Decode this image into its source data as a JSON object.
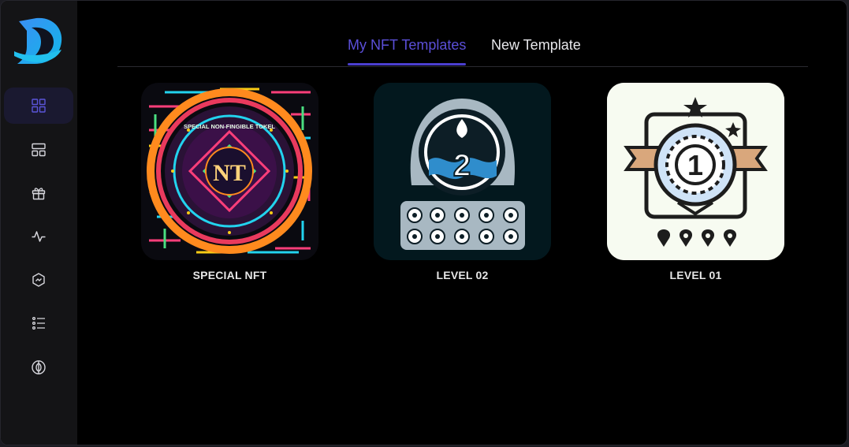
{
  "tabs": {
    "my_templates": "My NFT Templates",
    "new_template": "New Template"
  },
  "sidebar": {
    "items": [
      {
        "icon": "dashboard-grid-icon",
        "active": true
      },
      {
        "icon": "layout-icon",
        "active": false
      },
      {
        "icon": "gift-icon",
        "active": false
      },
      {
        "icon": "activity-icon",
        "active": false
      },
      {
        "icon": "badge-icon",
        "active": false
      },
      {
        "icon": "list-icon",
        "active": false
      },
      {
        "icon": "brain-icon",
        "active": false
      }
    ]
  },
  "cards": [
    {
      "title": "SPECIAL NFT",
      "image_text": [
        "SPECIAL NON-FINGIBLE TOKEL",
        "NT"
      ]
    },
    {
      "title": "LEVEL 02",
      "image_text": [
        "2"
      ]
    },
    {
      "title": "LEVEL 01",
      "image_text": [
        "1"
      ]
    }
  ],
  "colors": {
    "accent": "#4b3fcf",
    "background": "#000000",
    "sidebar": "#141416",
    "active_nav": "#1a1930"
  }
}
